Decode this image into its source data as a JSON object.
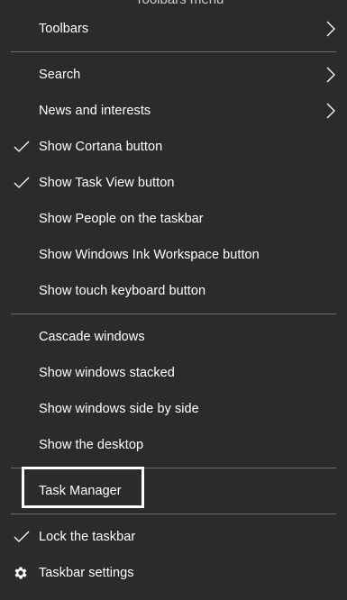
{
  "header": {
    "partial_title": "Toolbars menu"
  },
  "menu": {
    "toolbars": "Toolbars",
    "search": "Search",
    "news": "News and interests",
    "cortana": "Show Cortana button",
    "task_view": "Show Task View button",
    "people": "Show People on the taskbar",
    "ink": "Show Windows Ink Workspace button",
    "touch_keyboard": "Show touch keyboard button",
    "cascade": "Cascade windows",
    "stacked": "Show windows stacked",
    "side_by_side": "Show windows side by side",
    "desktop": "Show the desktop",
    "task_manager": "Task Manager",
    "lock": "Lock the taskbar",
    "settings": "Taskbar settings"
  },
  "checked": {
    "cortana": true,
    "task_view": true,
    "lock": true
  },
  "colors": {
    "background": "#2b2b2b",
    "text": "#ffffff",
    "separator": "#6d6d6d",
    "highlight": "#ffffff"
  }
}
